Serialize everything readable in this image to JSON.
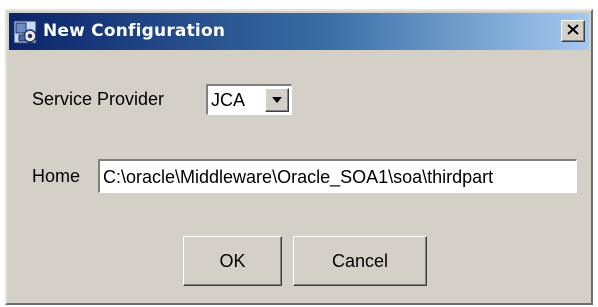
{
  "window": {
    "title": "New Configuration",
    "icon": "app-icon",
    "close_icon": "close-icon"
  },
  "service_provider": {
    "label": "Service Provider",
    "selected": "JCA"
  },
  "home": {
    "label": "Home",
    "value": "C:\\oracle\\Middleware\\Oracle_SOA1\\soa\\thirdpart"
  },
  "buttons": {
    "ok": "OK",
    "cancel": "Cancel"
  },
  "colors": {
    "dialog_bg": "#d4d0c8",
    "title_start": "#0a246a",
    "title_end": "#a6caf0"
  }
}
